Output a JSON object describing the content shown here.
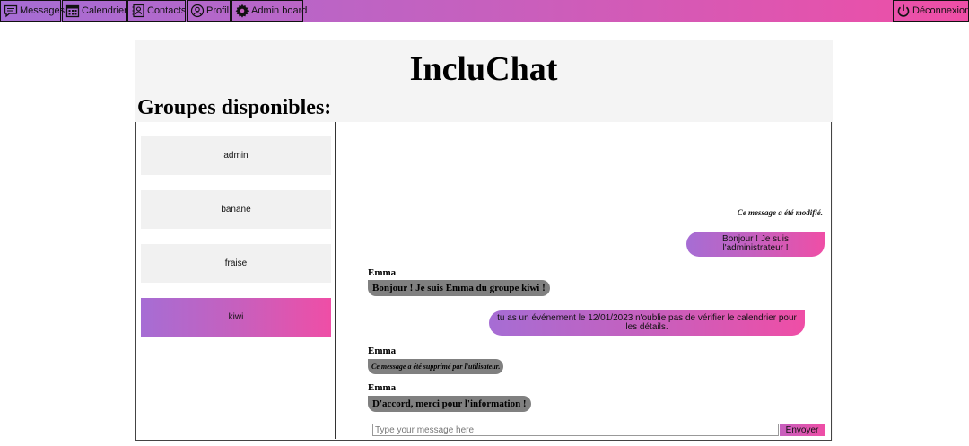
{
  "nav": {
    "messages": "Messages",
    "calendar": "Calendrier",
    "contacts": "Contacts",
    "profile": "Profil",
    "admin": "Admin board",
    "logout": "Déconnexion",
    "icons": [
      "messages-icon",
      "calendar-icon",
      "contacts-icon",
      "profile-icon",
      "gear-icon",
      "power-icon"
    ]
  },
  "app": {
    "title": "IncluChat"
  },
  "groups": {
    "heading": "Groupes disponibles:",
    "items": [
      {
        "label": "admin",
        "active": false
      },
      {
        "label": "banane",
        "active": false
      },
      {
        "label": "fraise",
        "active": false
      },
      {
        "label": "kiwi",
        "active": true
      }
    ]
  },
  "chat": {
    "edited_note": "Ce message a été modifié.",
    "messages": [
      {
        "direction": "out",
        "text": "Bonjour ! Je suis l'administrateur !"
      },
      {
        "direction": "in",
        "sender": "Emma",
        "text": "Bonjour ! Je suis Emma du groupe kiwi !"
      },
      {
        "direction": "out",
        "text": "tu as un événement le 12/01/2023 n'oublie pas de vérifier le calendrier pour les détails."
      },
      {
        "direction": "in",
        "sender": "Emma",
        "text": "Ce message a été supprimé par l'utilisateur.",
        "deleted": true
      },
      {
        "direction": "in",
        "sender": "Emma",
        "text": "D'accord, merci pour l'information !"
      }
    ],
    "input_placeholder": "Type your message here",
    "send_label": "Envoyer"
  },
  "colors": {
    "gradient_start": "#a66dd4",
    "gradient_end": "#ef4ea6",
    "incoming_bubble": "#808080",
    "panel_bg": "#f4f4f4"
  }
}
